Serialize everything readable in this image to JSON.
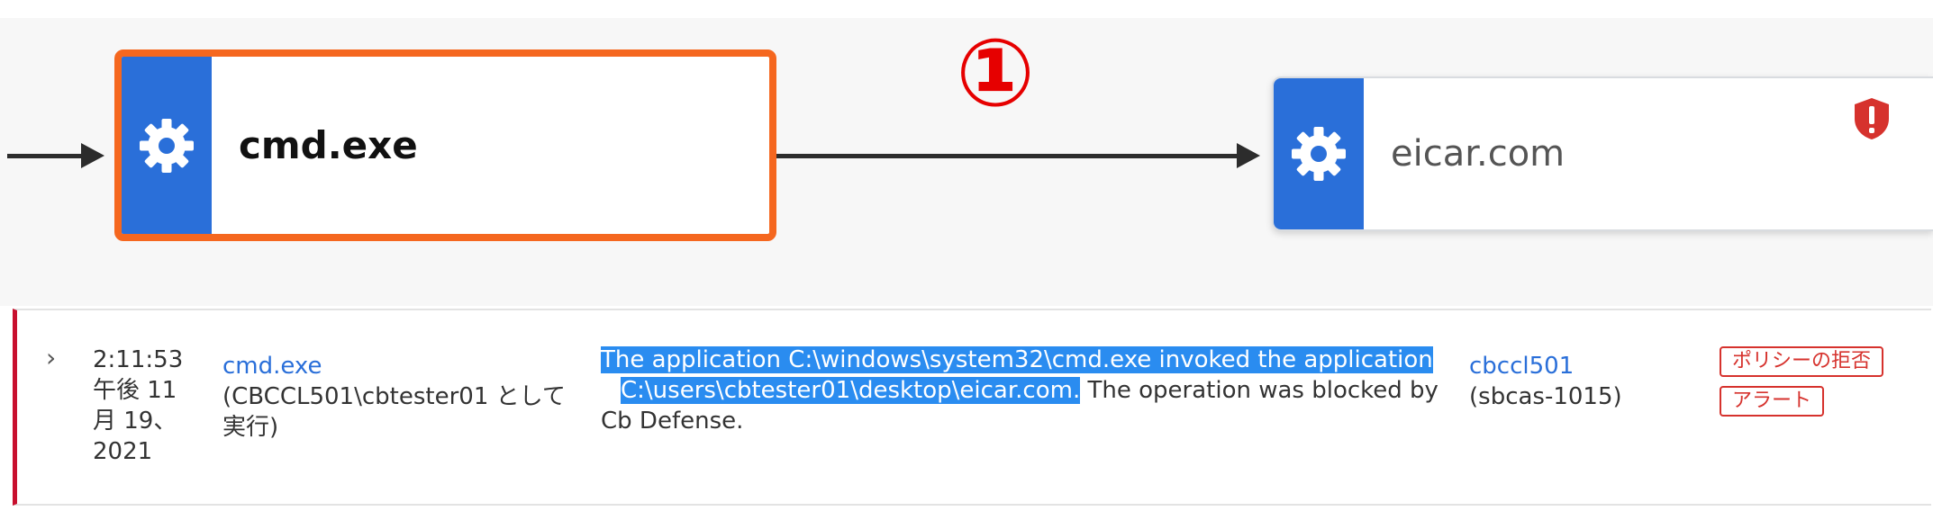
{
  "graph": {
    "source_node": {
      "label": "cmd.exe",
      "icon": "gear-icon"
    },
    "target_node": {
      "label": "eicar.com",
      "icon": "gear-icon",
      "alert_icon": "alert-shield-icon"
    },
    "step_marker": "①"
  },
  "event": {
    "time_line1": "2:11:53",
    "time_line2": "午後 11",
    "time_line3": "月 19、",
    "time_line4": "2021",
    "process_name": "cmd.exe",
    "process_user_line1": "(CBCCL501\\cbtester01 として",
    "process_user_line2": "実行)",
    "description_highlight_1": "The application C:\\windows\\system32\\cmd.exe invoked the application",
    "description_highlight_2": "C:\\users\\cbtester01\\desktop\\eicar.com.",
    "description_rest": " The operation was blocked by",
    "description_line3": "Cb Defense.",
    "device_name": "cbccl501",
    "device_id": "(sbcas-1015)",
    "tags": [
      "ポリシーの拒否",
      "アラート"
    ]
  },
  "colors": {
    "node_icon_bg": "#2a6fd9",
    "selected_border": "#f5671f",
    "highlight": "#2a8cf0",
    "tag_red": "#d6322d",
    "row_accent": "#c8102e",
    "marker_red": "#e60000"
  }
}
